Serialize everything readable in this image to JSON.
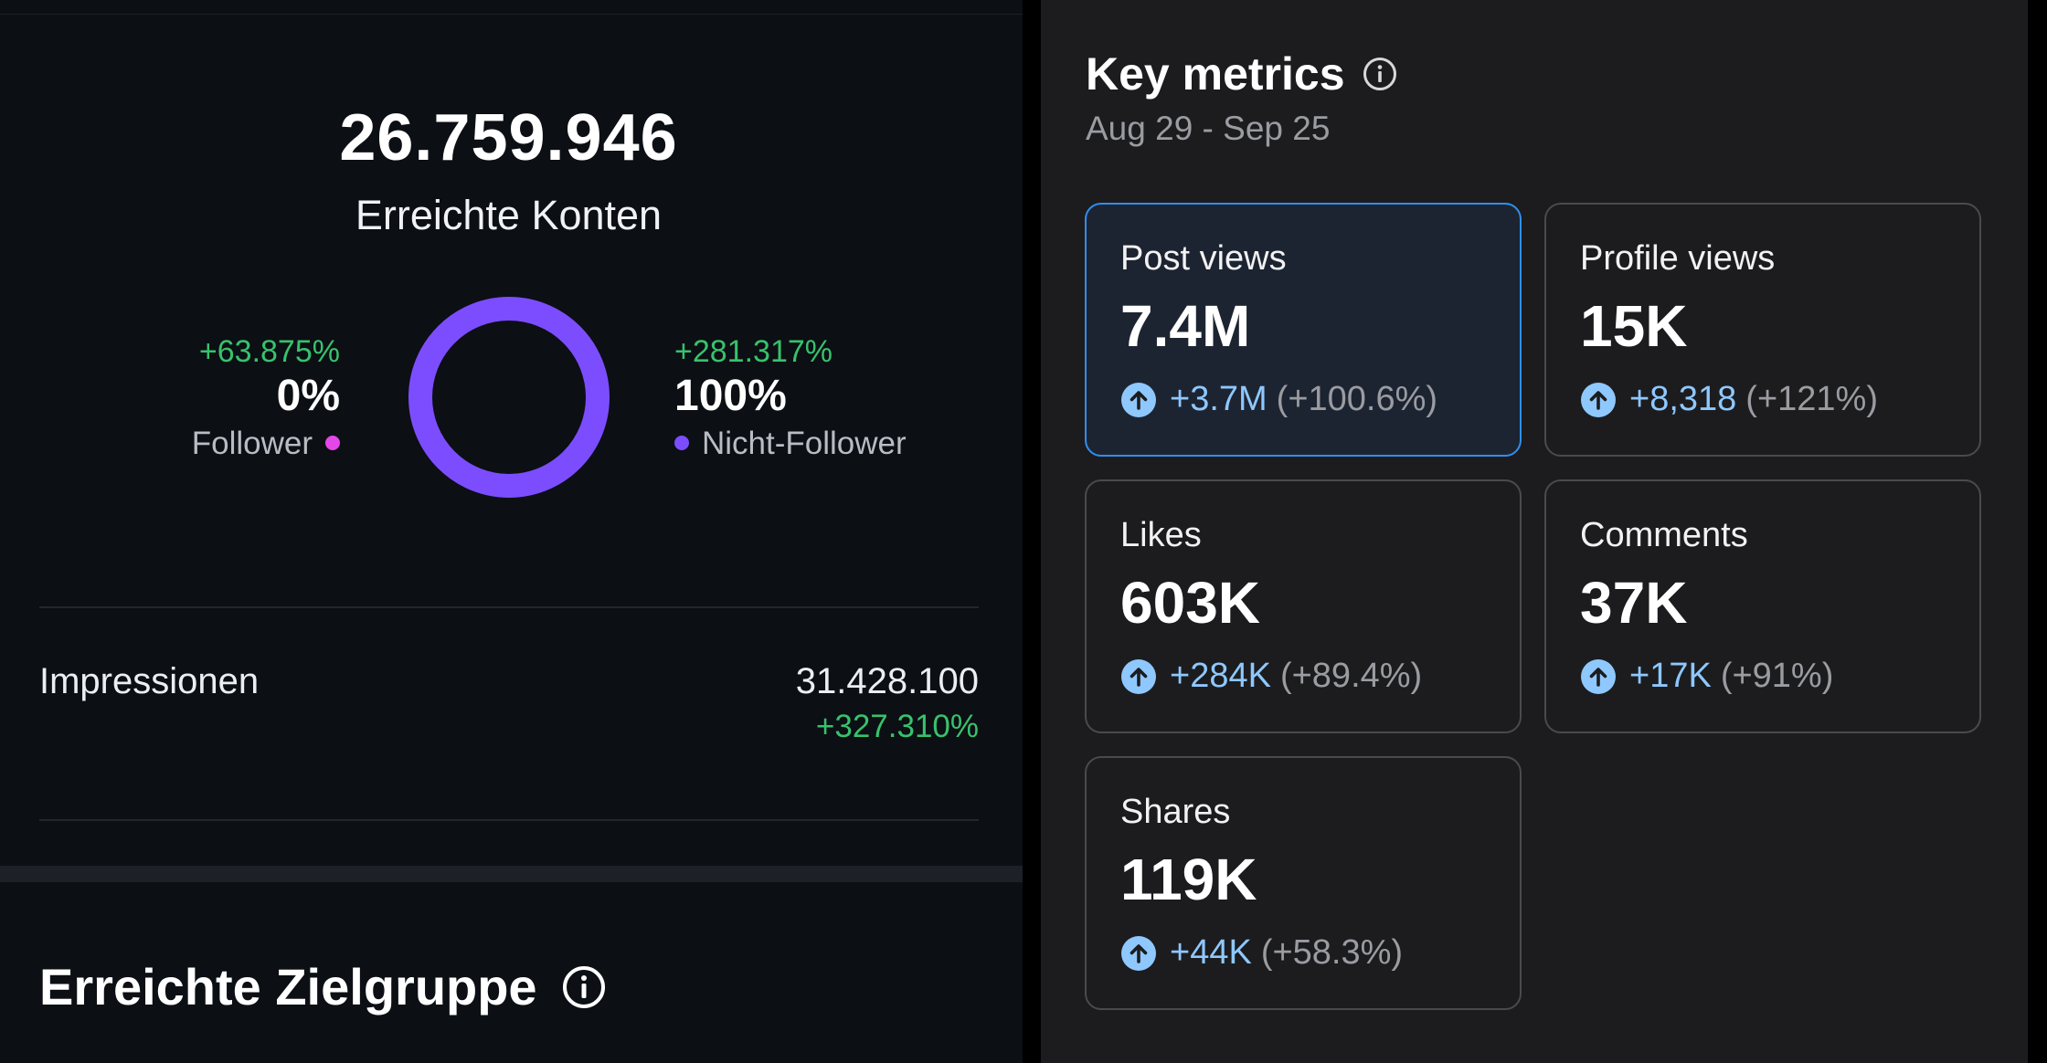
{
  "reach": {
    "value": "26.759.946",
    "label": "Erreichte Konten",
    "follower": {
      "change": "+63.875%",
      "percent": "0%",
      "label": "Follower",
      "color": "#e447e9",
      "share": 0
    },
    "non_follower": {
      "change": "+281.317%",
      "percent": "100%",
      "label": "Nicht-Follower",
      "color": "#7c4dff",
      "share": 1.0
    }
  },
  "impressions": {
    "label": "Impressionen",
    "value": "31.428.100",
    "change": "+327.310%"
  },
  "audience": {
    "title": "Erreichte Zielgruppe",
    "icon": "info-icon"
  },
  "key_metrics": {
    "title": "Key metrics",
    "icon": "info-icon",
    "range": "Aug 29 - Sep 25",
    "cards": [
      {
        "label": "Post views",
        "value": "7.4M",
        "change_abs": "+3.7M",
        "change_pct": "(+100.6%)",
        "active": true,
        "icon": "arrow-up-circle-icon"
      },
      {
        "label": "Profile views",
        "value": "15K",
        "change_abs": "+8,318",
        "change_pct": "(+121%)",
        "active": false,
        "icon": "arrow-up-circle-icon"
      },
      {
        "label": "Likes",
        "value": "603K",
        "change_abs": "+284K",
        "change_pct": "(+89.4%)",
        "active": false,
        "icon": "arrow-up-circle-icon"
      },
      {
        "label": "Comments",
        "value": "37K",
        "change_abs": "+17K",
        "change_pct": "(+91%)",
        "active": false,
        "icon": "arrow-up-circle-icon"
      },
      {
        "label": "Shares",
        "value": "119K",
        "change_abs": "+44K",
        "change_pct": "(+58.3%)",
        "active": false,
        "icon": "arrow-up-circle-icon"
      }
    ]
  },
  "colors": {
    "positive": "#37c26c",
    "accent_blue": "#8ec8ff",
    "active_border": "#2f8ff0"
  }
}
